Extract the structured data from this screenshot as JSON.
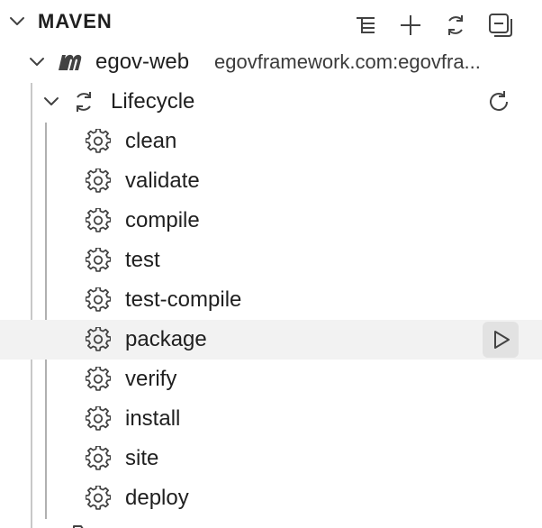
{
  "section": {
    "title": "MAVEN",
    "toolbar": [
      {
        "icon": "list-flat-icon",
        "action": "toggle-view"
      },
      {
        "icon": "add-icon",
        "action": "add"
      },
      {
        "icon": "refresh-icon",
        "action": "refresh"
      },
      {
        "icon": "collapse-all-icon",
        "action": "collapse-all"
      }
    ]
  },
  "project": {
    "name": "egov-web",
    "coordinates": "egovframework.com:egovfra..."
  },
  "lifecycle": {
    "label": "Lifecycle",
    "goals": [
      {
        "label": "clean"
      },
      {
        "label": "validate"
      },
      {
        "label": "compile"
      },
      {
        "label": "test"
      },
      {
        "label": "test-compile"
      },
      {
        "label": "package",
        "hovered": true
      },
      {
        "label": "verify"
      },
      {
        "label": "install"
      },
      {
        "label": "site"
      },
      {
        "label": "deploy"
      }
    ]
  },
  "colors": {
    "icon": "#424242",
    "hover_row": "#f2f2f2",
    "run_button_bg": "#e2e2e2"
  }
}
